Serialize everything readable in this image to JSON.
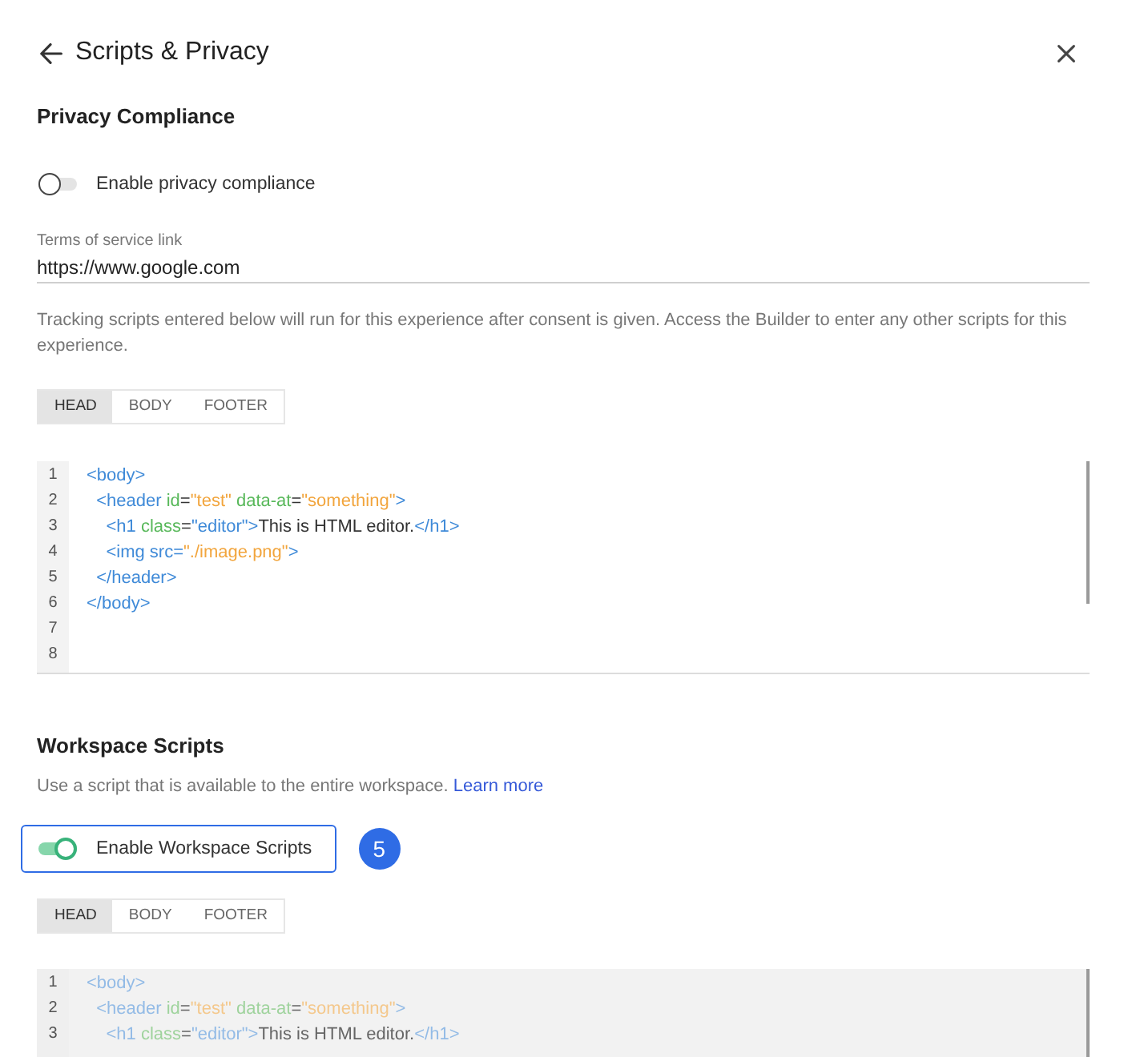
{
  "header": {
    "title": "Scripts & Privacy"
  },
  "privacy_compliance": {
    "heading": "Privacy Compliance",
    "toggle": {
      "label": "Enable privacy compliance",
      "on": false
    },
    "terms_field": {
      "label": "Terms of service link",
      "value": "https://www.google.com"
    },
    "description": "Tracking scripts entered below will run for this experience after consent is given. Access the Builder to enter any other scripts for this experience.",
    "tabs": [
      {
        "label": "HEAD",
        "selected": true
      },
      {
        "label": "BODY",
        "selected": false
      },
      {
        "label": "FOOTER",
        "selected": false
      }
    ],
    "editor": {
      "disabled": false,
      "lines": [
        {
          "number": "1",
          "tokens": [
            {
              "kind": "tag",
              "text": "<body>"
            }
          ]
        },
        {
          "number": "2",
          "tokens": [
            {
              "kind": "tag",
              "text": "  <header"
            },
            {
              "kind": "attr",
              "text": " id"
            },
            {
              "kind": "punct",
              "text": "="
            },
            {
              "kind": "value",
              "text": "\"test\""
            },
            {
              "kind": "attr",
              "text": " data-at"
            },
            {
              "kind": "punct",
              "text": "="
            },
            {
              "kind": "value",
              "text": "\"something\""
            },
            {
              "kind": "tag",
              "text": ">"
            }
          ]
        },
        {
          "number": "3",
          "tokens": [
            {
              "kind": "tag",
              "text": "    <h1"
            },
            {
              "kind": "attr",
              "text": " class"
            },
            {
              "kind": "punct",
              "text": "="
            },
            {
              "kind": "tag",
              "text": "\"editor\">"
            },
            {
              "kind": "text",
              "text": "This is HTML editor."
            },
            {
              "kind": "tag",
              "text": "</h1>"
            }
          ]
        },
        {
          "number": "4",
          "tokens": [
            {
              "kind": "tag",
              "text": "    <img src="
            },
            {
              "kind": "value",
              "text": "\"./image.png\""
            },
            {
              "kind": "tag",
              "text": ">"
            }
          ]
        },
        {
          "number": "5",
          "tokens": [
            {
              "kind": "tag",
              "text": "  </header>"
            }
          ]
        },
        {
          "number": "6",
          "tokens": [
            {
              "kind": "tag",
              "text": "</body>"
            }
          ]
        },
        {
          "number": "7"
        },
        {
          "number": "8"
        }
      ]
    }
  },
  "workspace_scripts": {
    "heading": "Workspace Scripts",
    "description": "Use a script that is available to the entire workspace.",
    "link": "Learn more",
    "toggle": {
      "label": "Enable Workspace Scripts",
      "on": true,
      "focused": true
    },
    "step_badge": "5",
    "tabs": [
      {
        "label": "HEAD",
        "selected": true
      },
      {
        "label": "BODY",
        "selected": false
      },
      {
        "label": "FOOTER",
        "selected": false
      }
    ],
    "editor": {
      "disabled": true,
      "lines": [
        {
          "number": "1",
          "tokens": [
            {
              "kind": "tag",
              "text": "<body>"
            }
          ]
        },
        {
          "number": "2",
          "tokens": [
            {
              "kind": "tag",
              "text": "  <header"
            },
            {
              "kind": "attr",
              "text": " id"
            },
            {
              "kind": "punct",
              "text": "="
            },
            {
              "kind": "value",
              "text": "\"test\""
            },
            {
              "kind": "attr",
              "text": " data-at"
            },
            {
              "kind": "punct",
              "text": "="
            },
            {
              "kind": "value",
              "text": "\"something\""
            },
            {
              "kind": "tag",
              "text": ">"
            }
          ]
        },
        {
          "number": "3",
          "tokens": [
            {
              "kind": "tag",
              "text": "    <h1"
            },
            {
              "kind": "attr",
              "text": " class"
            },
            {
              "kind": "punct",
              "text": "="
            },
            {
              "kind": "tag",
              "text": "\"editor\">"
            },
            {
              "kind": "text",
              "text": "This is HTML editor."
            },
            {
              "kind": "tag",
              "text": "</h1>"
            }
          ]
        }
      ]
    }
  }
}
